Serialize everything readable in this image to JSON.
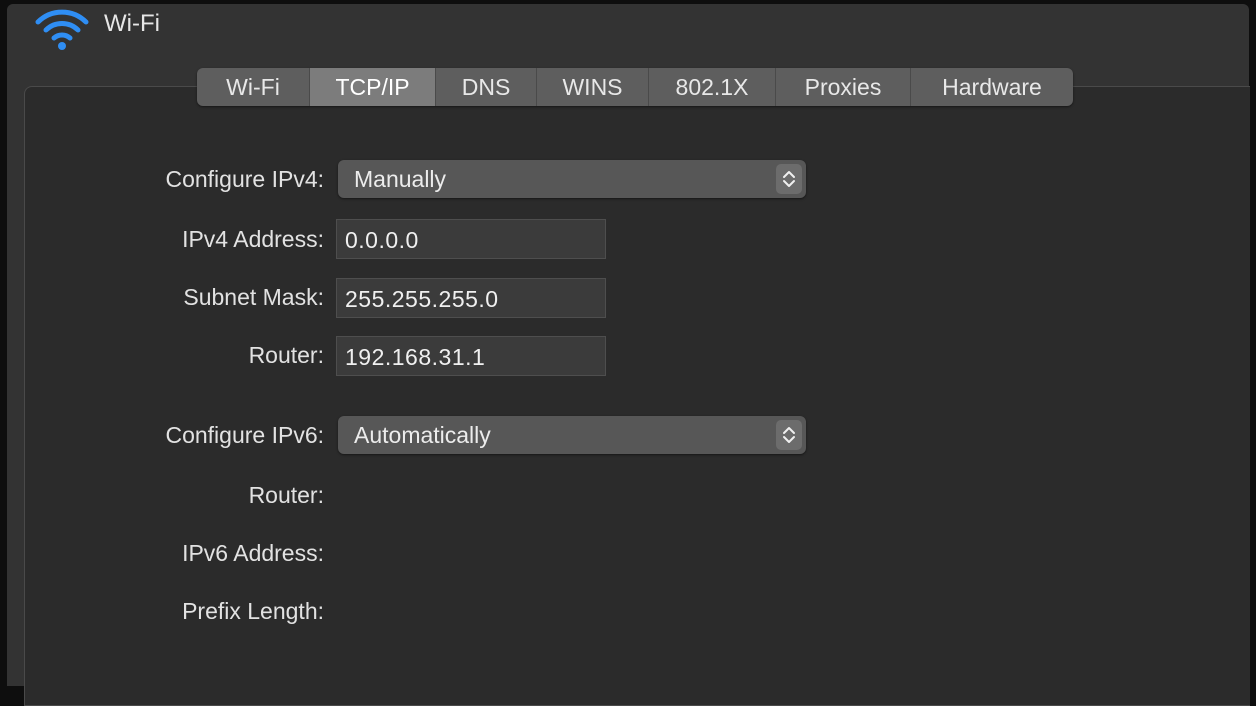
{
  "header": {
    "title": "Wi-Fi",
    "icon": "wifi-icon",
    "icon_color": "#2f8ef4"
  },
  "tabs": [
    {
      "label": "Wi-Fi",
      "active": false
    },
    {
      "label": "TCP/IP",
      "active": true
    },
    {
      "label": "DNS",
      "active": false
    },
    {
      "label": "WINS",
      "active": false
    },
    {
      "label": "802.1X",
      "active": false
    },
    {
      "label": "Proxies",
      "active": false
    },
    {
      "label": "Hardware",
      "active": false
    }
  ],
  "ipv4": {
    "configure_label": "Configure IPv4:",
    "configure_value": "Manually",
    "address_label": "IPv4 Address:",
    "address_value": "0.0.0.0",
    "subnet_label": "Subnet Mask:",
    "subnet_value": "255.255.255.0",
    "router_label": "Router:",
    "router_value": "192.168.31.1"
  },
  "ipv6": {
    "configure_label": "Configure IPv6:",
    "configure_value": "Automatically",
    "router_label": "Router:",
    "address_label": "IPv6 Address:",
    "prefix_label": "Prefix Length:"
  }
}
